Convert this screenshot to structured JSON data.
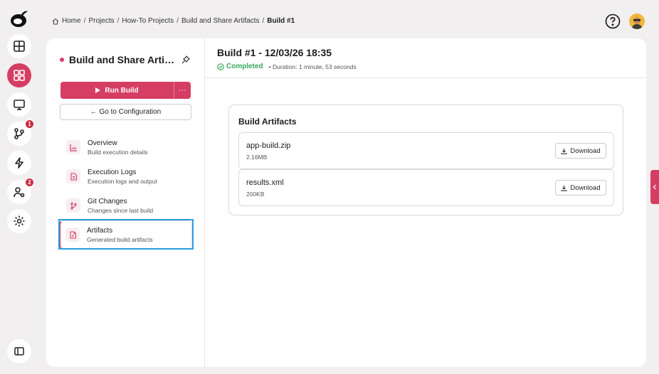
{
  "breadcrumb": {
    "items": [
      "Home",
      "Projects",
      "How-To Projects",
      "Build and Share Artifacts"
    ],
    "current": "Build #1",
    "separator": "/"
  },
  "rail": {
    "icons": [
      "logo-icon",
      "table-icon",
      "dashboard-icon",
      "monitor-icon",
      "git-branch-icon",
      "lightning-icon",
      "users-settings-icon",
      "gear-icon",
      "sidebar-toggle-icon"
    ],
    "badges": {
      "git": "1",
      "users": "2"
    }
  },
  "sidebar": {
    "title": "Build and Share Artifacts",
    "run_build_label": "Run Build",
    "more_label": "···",
    "goto_config_label": "← Go to Configuration",
    "items": [
      {
        "title": "Overview",
        "subtitle": "Build execution details",
        "icon": "chart-icon"
      },
      {
        "title": "Execution Logs",
        "subtitle": "Execution logs and output",
        "icon": "document-icon"
      },
      {
        "title": "Git Changes",
        "subtitle": "Changes since last build",
        "icon": "git-branch-icon"
      },
      {
        "title": "Artifacts",
        "subtitle": "Generated build artifacts",
        "icon": "file-icon"
      }
    ]
  },
  "build": {
    "title": "Build #1 - 12/03/26 18:35",
    "status": "Completed",
    "duration": "• Duration: 1 minute, 53 seconds"
  },
  "artifacts": {
    "title": "Build Artifacts",
    "download_label": "Download",
    "items": [
      {
        "name": "app-build.zip",
        "size": "2.16MB"
      },
      {
        "name": "results.xml",
        "size": "200KB"
      }
    ]
  },
  "colors": {
    "accent": "#d63d63",
    "success": "#3aa85c",
    "focus": "#2b9be0",
    "badge": "#c8283e"
  }
}
